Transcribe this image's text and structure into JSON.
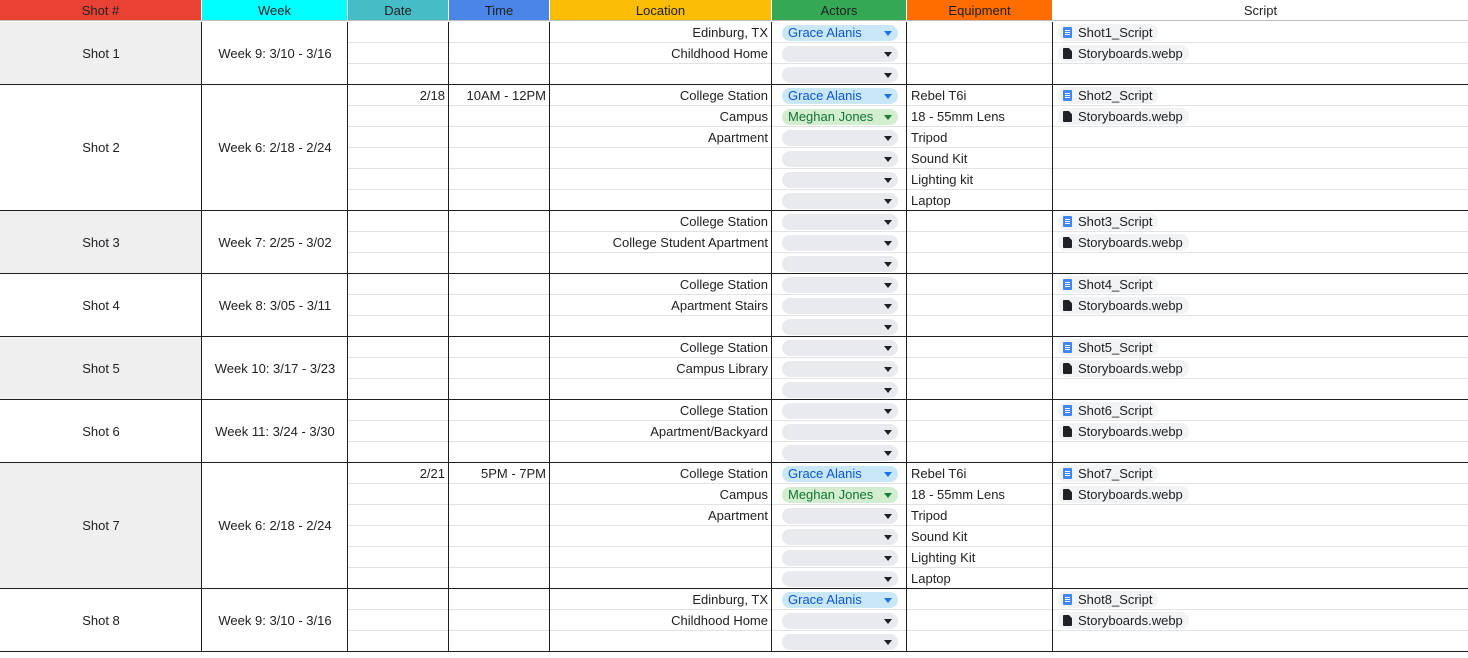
{
  "headers": [
    {
      "key": "shot",
      "label": "Shot #",
      "color": "#e94235"
    },
    {
      "key": "week",
      "label": "Week",
      "color": "#00ffff"
    },
    {
      "key": "date",
      "label": "Date",
      "color": "#46bdc6"
    },
    {
      "key": "time",
      "label": "Time",
      "color": "#4a86e8"
    },
    {
      "key": "location",
      "label": "Location",
      "color": "#fbbc04"
    },
    {
      "key": "actors",
      "label": "Actors",
      "color": "#34a853"
    },
    {
      "key": "equipment",
      "label": "Equipment",
      "color": "#ff6d01"
    },
    {
      "key": "script",
      "label": "Script",
      "color": "#ffffff"
    }
  ],
  "chip_colors": {
    "blue_bg": "#c9e7f7",
    "blue_text": "#0b57d0",
    "green_bg": "#d2eecf",
    "green_text": "#137333",
    "empty_bg": "#e8eaed",
    "shaded_row_bg": "#efefef"
  },
  "shots": [
    {
      "shot": "Shot 1",
      "week": "Week 9: 3/10 - 3/16",
      "shaded": true,
      "date": "",
      "time": "",
      "location": [
        "Edinburg, TX",
        "Childhood Home",
        ""
      ],
      "actors": [
        {
          "name": "Grace Alanis",
          "color": "blue"
        },
        {
          "name": "",
          "color": "empty"
        },
        {
          "name": "",
          "color": "empty"
        }
      ],
      "equipment": [
        "",
        "",
        ""
      ],
      "files": [
        {
          "name": "Shot1_Script",
          "type": "doc"
        },
        {
          "name": "Storyboards.webp",
          "type": "file"
        }
      ]
    },
    {
      "shot": "Shot 2",
      "week": "Week 6: 2/18 - 2/24",
      "shaded": false,
      "date": "2/18",
      "time": "10AM - 12PM",
      "location": [
        "College Station",
        "Campus",
        "Apartment",
        "",
        "",
        ""
      ],
      "actors": [
        {
          "name": "Grace Alanis",
          "color": "blue"
        },
        {
          "name": "Meghan Jones",
          "color": "green"
        },
        {
          "name": "",
          "color": "empty"
        },
        {
          "name": "",
          "color": "empty"
        },
        {
          "name": "",
          "color": "empty"
        },
        {
          "name": "",
          "color": "empty"
        }
      ],
      "equipment": [
        "Rebel T6i",
        "18 - 55mm Lens",
        "Tripod",
        "Sound Kit",
        "Lighting kit",
        "Laptop"
      ],
      "files": [
        {
          "name": "Shot2_Script",
          "type": "doc"
        },
        {
          "name": "Storyboards.webp",
          "type": "file"
        }
      ]
    },
    {
      "shot": "Shot 3",
      "week": "Week 7: 2/25 - 3/02",
      "shaded": true,
      "date": "",
      "time": "",
      "location": [
        "College Station",
        "College Student Apartment",
        ""
      ],
      "actors": [
        {
          "name": "",
          "color": "empty"
        },
        {
          "name": "",
          "color": "empty"
        },
        {
          "name": "",
          "color": "empty"
        }
      ],
      "equipment": [
        "",
        "",
        ""
      ],
      "files": [
        {
          "name": "Shot3_Script",
          "type": "doc"
        },
        {
          "name": "Storyboards.webp",
          "type": "file"
        }
      ]
    },
    {
      "shot": "Shot 4",
      "week": "Week 8: 3/05 - 3/11",
      "shaded": false,
      "date": "",
      "time": "",
      "location": [
        "College Station",
        "Apartment Stairs",
        ""
      ],
      "actors": [
        {
          "name": "",
          "color": "empty"
        },
        {
          "name": "",
          "color": "empty"
        },
        {
          "name": "",
          "color": "empty"
        }
      ],
      "equipment": [
        "",
        "",
        ""
      ],
      "files": [
        {
          "name": "Shot4_Script",
          "type": "doc"
        },
        {
          "name": "Storyboards.webp",
          "type": "file"
        }
      ]
    },
    {
      "shot": "Shot 5",
      "week": "Week 10: 3/17 - 3/23",
      "shaded": true,
      "date": "",
      "time": "",
      "location": [
        "College Station",
        "Campus Library",
        ""
      ],
      "actors": [
        {
          "name": "",
          "color": "empty"
        },
        {
          "name": "",
          "color": "empty"
        },
        {
          "name": "",
          "color": "empty"
        }
      ],
      "equipment": [
        "",
        "",
        ""
      ],
      "files": [
        {
          "name": "Shot5_Script",
          "type": "doc"
        },
        {
          "name": "Storyboards.webp",
          "type": "file"
        }
      ]
    },
    {
      "shot": "Shot 6",
      "week": "Week 11: 3/24 - 3/30",
      "shaded": false,
      "date": "",
      "time": "",
      "location": [
        "College Station",
        "Apartment/Backyard",
        ""
      ],
      "actors": [
        {
          "name": "",
          "color": "empty"
        },
        {
          "name": "",
          "color": "empty"
        },
        {
          "name": "",
          "color": "empty"
        }
      ],
      "equipment": [
        "",
        "",
        ""
      ],
      "files": [
        {
          "name": "Shot6_Script",
          "type": "doc"
        },
        {
          "name": "Storyboards.webp",
          "type": "file"
        }
      ]
    },
    {
      "shot": "Shot 7",
      "week": "Week 6: 2/18 - 2/24",
      "shaded": true,
      "date": "2/21",
      "time": "5PM - 7PM",
      "location": [
        "College Station",
        "Campus",
        "Apartment",
        "",
        "",
        ""
      ],
      "actors": [
        {
          "name": "Grace Alanis",
          "color": "blue"
        },
        {
          "name": "Meghan Jones",
          "color": "green"
        },
        {
          "name": "",
          "color": "empty"
        },
        {
          "name": "",
          "color": "empty"
        },
        {
          "name": "",
          "color": "empty"
        },
        {
          "name": "",
          "color": "empty"
        }
      ],
      "equipment": [
        "Rebel T6i",
        "18 - 55mm Lens",
        "Tripod",
        "Sound Kit",
        "Lighting Kit",
        "Laptop"
      ],
      "files": [
        {
          "name": "Shot7_Script",
          "type": "doc"
        },
        {
          "name": "Storyboards.webp",
          "type": "file"
        }
      ]
    },
    {
      "shot": "Shot 8",
      "week": "Week 9: 3/10 - 3/16",
      "shaded": false,
      "date": "",
      "time": "",
      "location": [
        "Edinburg, TX",
        "Childhood Home",
        ""
      ],
      "actors": [
        {
          "name": "Grace Alanis",
          "color": "blue"
        },
        {
          "name": "",
          "color": "empty"
        },
        {
          "name": "",
          "color": "empty"
        }
      ],
      "equipment": [
        "",
        "",
        ""
      ],
      "files": [
        {
          "name": "Shot8_Script",
          "type": "doc"
        },
        {
          "name": "Storyboards.webp",
          "type": "file"
        }
      ]
    }
  ]
}
